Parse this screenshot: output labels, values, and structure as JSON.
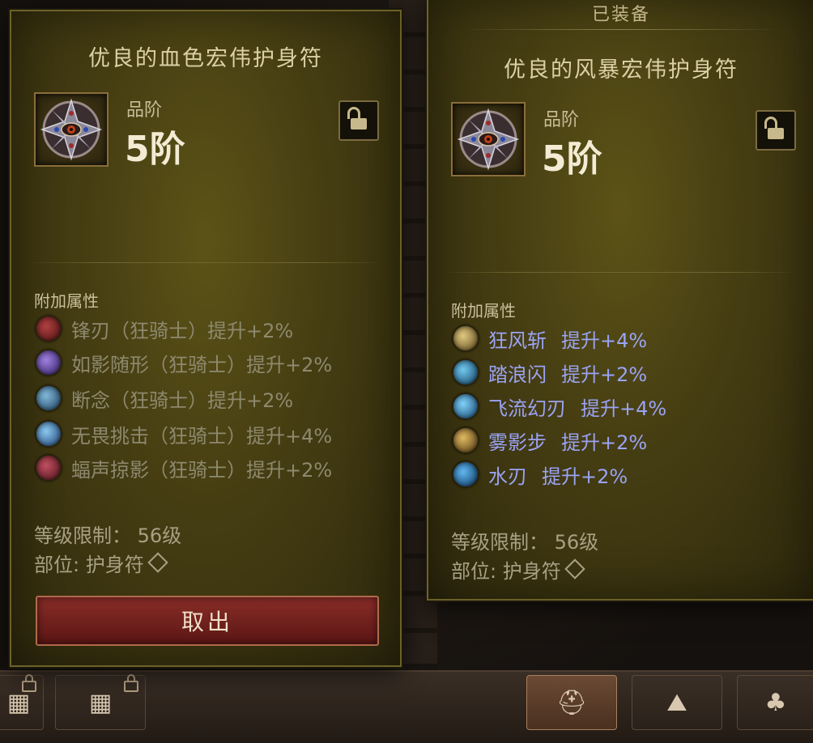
{
  "left_panel": {
    "title": "优良的血色宏伟护身符",
    "grade_label": "品阶",
    "grade_value": "5阶",
    "affix_section_title": "附加属性",
    "affixes": [
      {
        "text": "锋刃（狂骑士）提升+2%",
        "orb_color": "#7a2a2a"
      },
      {
        "text": "如影随形（狂骑士）提升+2%",
        "orb_color": "#6a4aa0"
      },
      {
        "text": "断念（狂骑士）提升+2%",
        "orb_color": "#3a6c8a"
      },
      {
        "text": "无畏挑击（狂骑士）提升+4%",
        "orb_color": "#4a7ab0"
      },
      {
        "text": "蝠声掠影（狂骑士）提升+2%",
        "orb_color": "#8a2a36"
      }
    ],
    "level_req": "等级限制：  56级",
    "slot": "部位: 护身符",
    "takeout_button": "取出"
  },
  "right_panel": {
    "equipped_label": "已装备",
    "title": "优良的风暴宏伟护身符",
    "grade_label": "品阶",
    "grade_value": "5阶",
    "affix_section_title": "附加属性",
    "affixes": [
      {
        "name": "狂风斩",
        "bonus": "提升+4%",
        "orb_color": "#b89a4a"
      },
      {
        "name": "踏浪闪",
        "bonus": "提升+2%",
        "orb_color": "#3a8ab8"
      },
      {
        "name": "飞流幻刃",
        "bonus": "提升+4%",
        "orb_color": "#3a9ac8"
      },
      {
        "name": "雾影步",
        "bonus": "提升+2%",
        "orb_color": "#a8823a"
      },
      {
        "name": "水刃",
        "bonus": "提升+2%",
        "orb_color": "#2a7ab0"
      }
    ],
    "level_req": "等级限制：  56级",
    "slot": "部位: 护身符"
  },
  "bottom_bar": {
    "slots": [
      {
        "icon": "chest-icon",
        "locked": true
      },
      {
        "icon": "chest-icon",
        "locked": true
      },
      {
        "icon": "helmet-icon",
        "active": true
      },
      {
        "icon": "shoulder-armor-icon"
      },
      {
        "icon": "pouch-icon"
      }
    ]
  }
}
